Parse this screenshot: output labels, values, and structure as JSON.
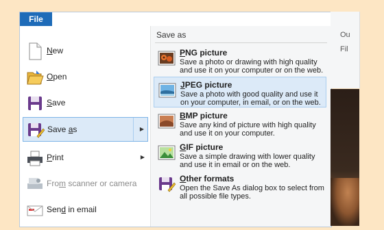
{
  "file_tab": {
    "label": "File"
  },
  "left_menu": [
    {
      "key": "new",
      "pre": "",
      "u": "N",
      "post": "ew",
      "icon": "new-document-icon",
      "disabled": false,
      "has_arrow": false
    },
    {
      "key": "open",
      "pre": "",
      "u": "O",
      "post": "pen",
      "icon": "open-folder-icon",
      "disabled": false,
      "has_arrow": false
    },
    {
      "key": "save",
      "pre": "",
      "u": "S",
      "post": "ave",
      "icon": "save-disk-icon",
      "disabled": false,
      "has_arrow": false
    },
    {
      "key": "save-as",
      "pre": "Save ",
      "u": "a",
      "post": "s",
      "icon": "save-as-icon",
      "disabled": false,
      "has_arrow": true,
      "selected": true
    },
    {
      "key": "print",
      "pre": "",
      "u": "P",
      "post": "rint",
      "icon": "printer-icon",
      "disabled": false,
      "has_arrow": true
    },
    {
      "key": "scanner",
      "pre": "Fro",
      "u": "m",
      "post": " scanner or camera",
      "icon": "scanner-icon",
      "disabled": true,
      "has_arrow": false
    },
    {
      "key": "email",
      "pre": "Sen",
      "u": "d",
      "post": " in email",
      "icon": "email-icon",
      "disabled": false,
      "has_arrow": false
    }
  ],
  "save_as_pane": {
    "title": "Save as",
    "items": [
      {
        "key": "png",
        "u": "P",
        "title_rest": "NG picture",
        "desc": "Save a photo or drawing with high quality and use it on your computer or on the web.",
        "icon": "png-picture-icon"
      },
      {
        "key": "jpeg",
        "u": "J",
        "title_rest": "PEG picture",
        "desc": "Save a photo with good quality and use it on your computer, in email, or on the web.",
        "icon": "jpeg-picture-icon",
        "hover": true
      },
      {
        "key": "bmp",
        "u": "B",
        "title_rest": "MP picture",
        "desc": "Save any kind of picture with high quality and use it on your computer.",
        "icon": "bmp-picture-icon"
      },
      {
        "key": "gif",
        "u": "G",
        "title_rest": "IF picture",
        "desc": "Save a simple drawing with lower quality and use it in email or on the web.",
        "icon": "gif-picture-icon"
      },
      {
        "key": "other",
        "u": "O",
        "title_rest": "ther formats",
        "desc": "Open the Save As dialog box to select from all possible file types.",
        "icon": "other-formats-icon"
      }
    ]
  },
  "ribbon_right": {
    "item1": "Ou",
    "item2": "Fil"
  },
  "colors": {
    "file_tab": "#1e6bb8",
    "selection": "#dceaf8",
    "selection_border": "#7db3e7",
    "background": "#fde6c4"
  }
}
